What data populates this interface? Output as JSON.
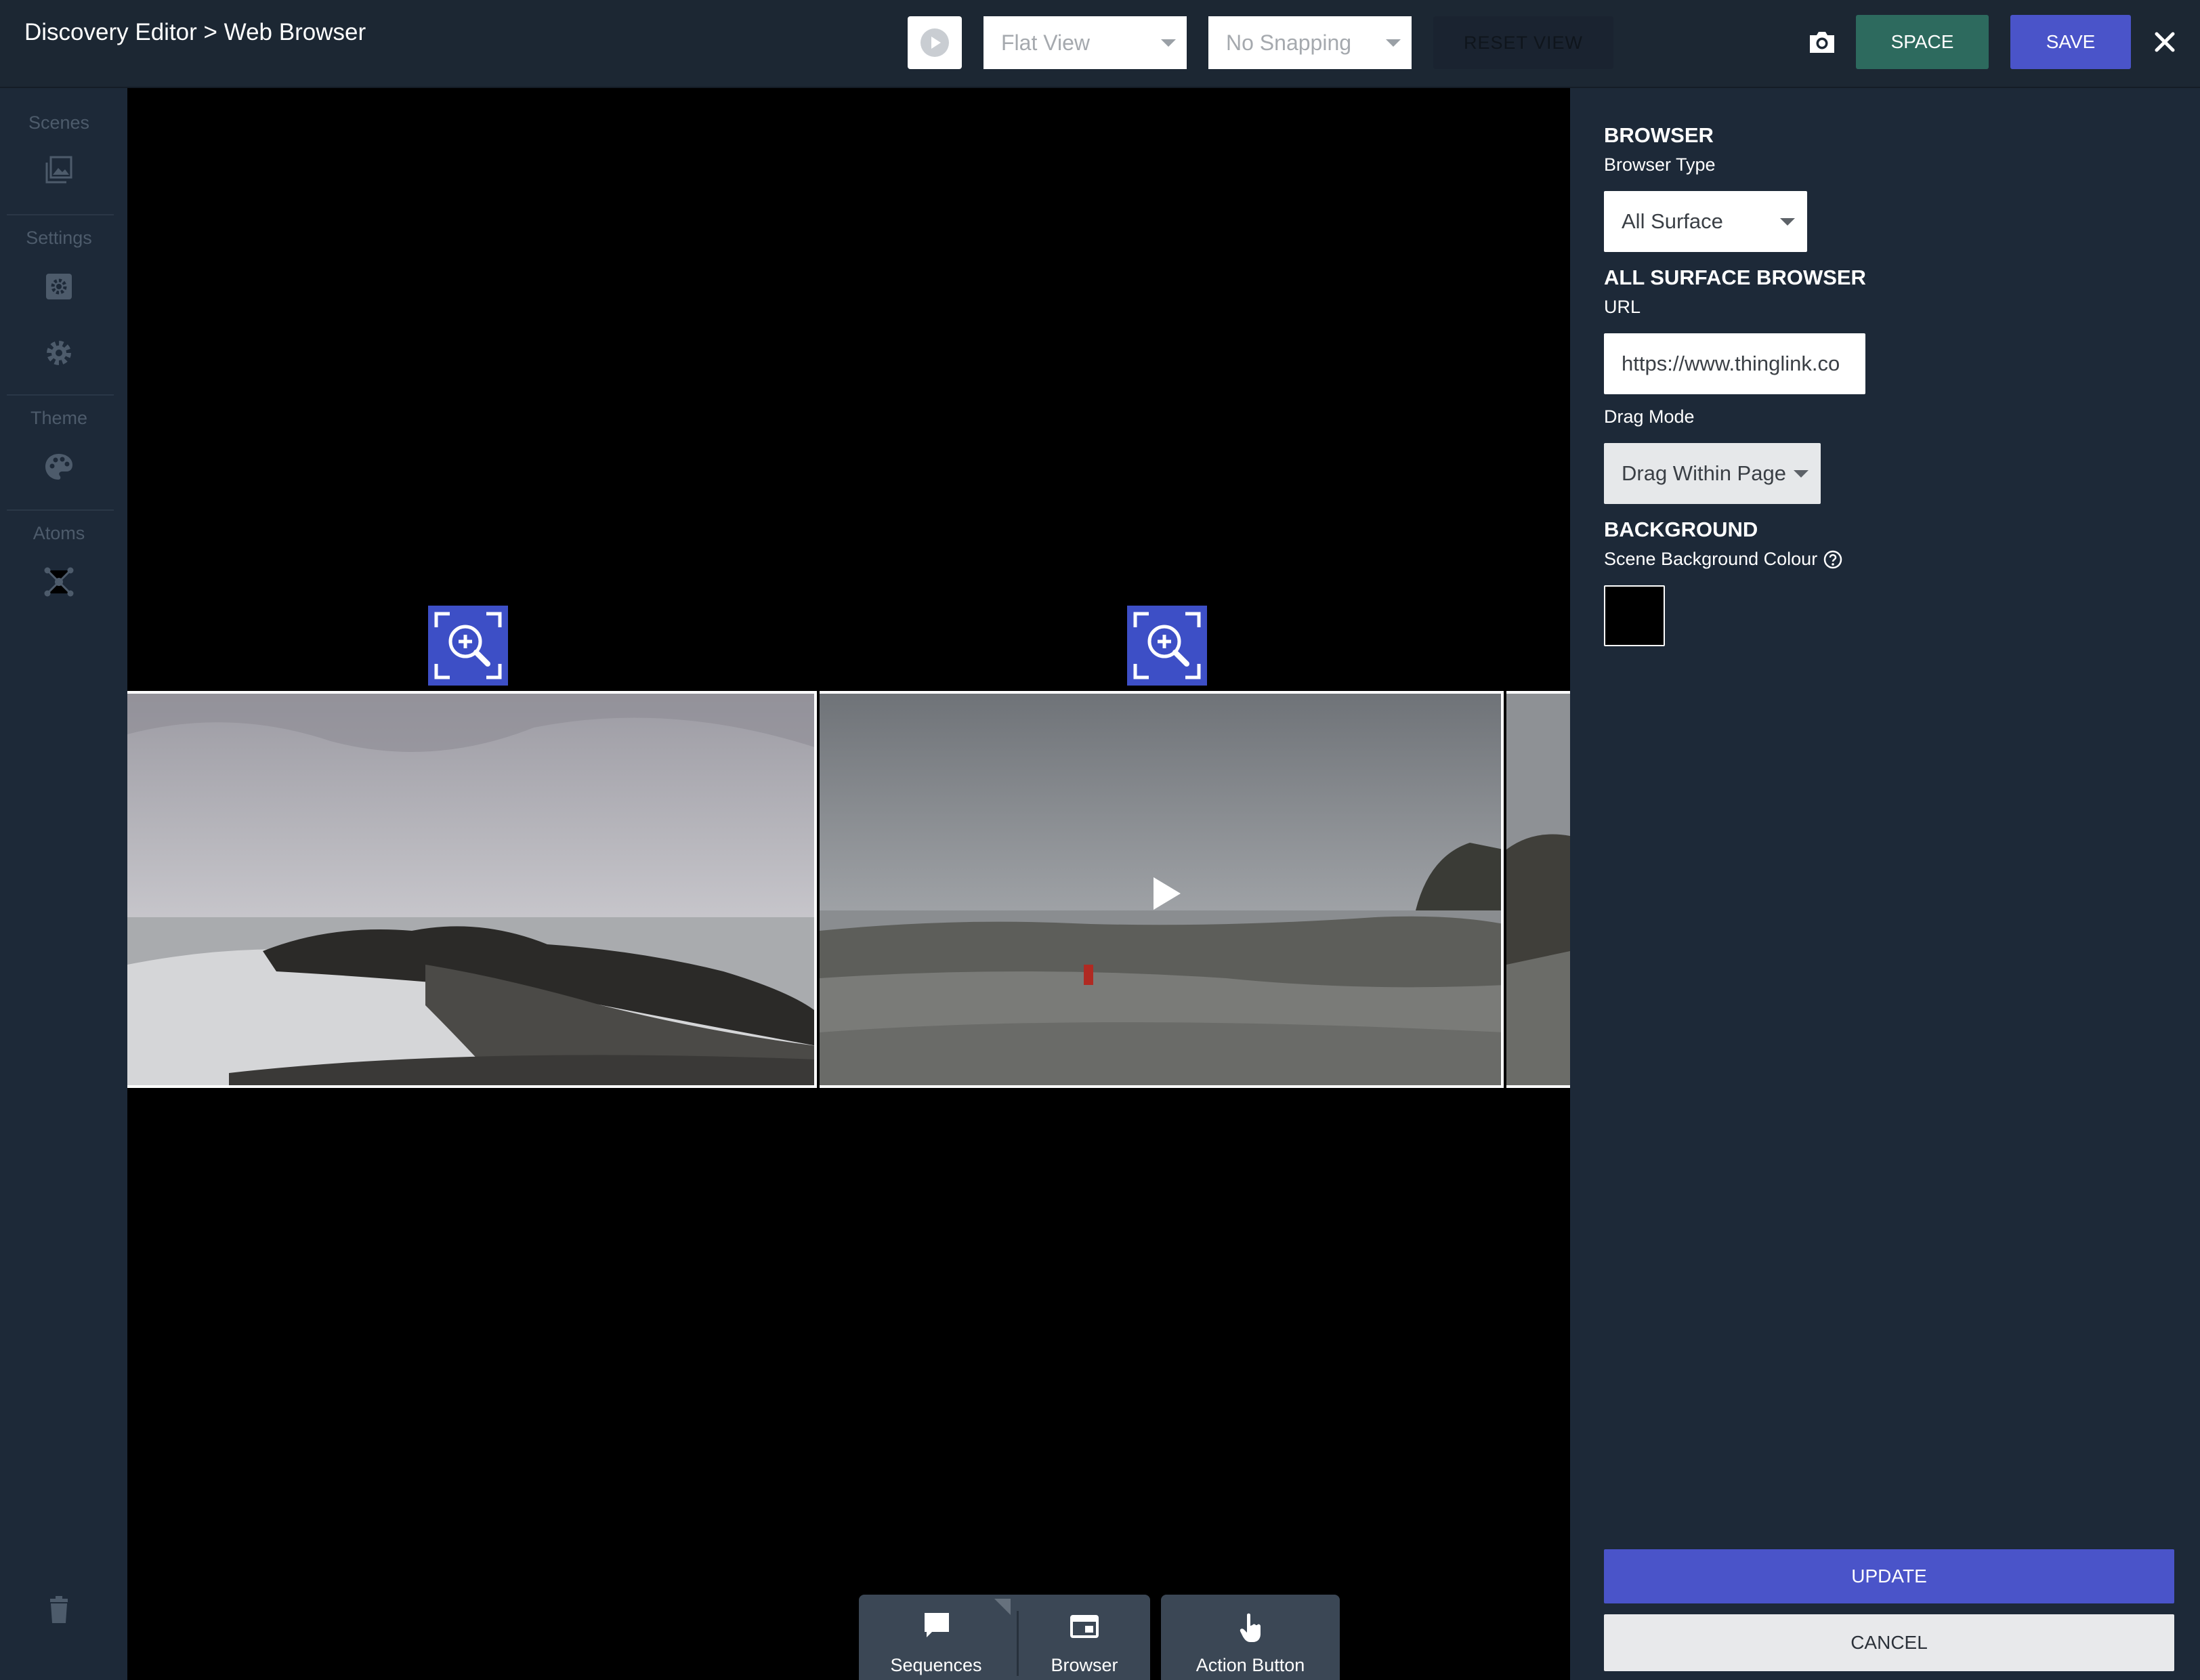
{
  "header": {
    "breadcrumb": "Discovery Editor > Web Browser",
    "view_mode": "Flat View",
    "snapping": "No Snapping",
    "reset_view": "RESET VIEW",
    "space_label": "SPACE",
    "save_label": "SAVE",
    "icons": [
      "play-icon",
      "camera-icon",
      "close-icon"
    ]
  },
  "sidebar": {
    "sections": [
      {
        "label": "Scenes",
        "icons": [
          "image-gallery-icon"
        ]
      },
      {
        "label": "Settings",
        "icons": [
          "scene-settings-icon",
          "gear-icon"
        ]
      },
      {
        "label": "Theme",
        "icons": [
          "palette-icon"
        ]
      },
      {
        "label": "Atoms",
        "icons": [
          "network-nodes-icon"
        ]
      }
    ],
    "footer_icon": "trash-icon"
  },
  "canvas": {
    "hotspot_icons": [
      "zoom-in-icon",
      "zoom-in-icon"
    ],
    "video_play_icon": "play-icon"
  },
  "bottom_tools": {
    "items": [
      {
        "label": "Sequences",
        "icon": "speech-bubble-icon"
      },
      {
        "label": "Browser",
        "icon": "browser-window-icon"
      },
      {
        "label": "Action Button",
        "icon": "pointer-hand-icon"
      }
    ]
  },
  "panel": {
    "browser_heading": "BROWSER",
    "browser_type_label": "Browser Type",
    "browser_type_value": "All Surface",
    "surface_heading": "ALL SURFACE BROWSER",
    "url_label": "URL",
    "url_value": "https://www.thinglink.co",
    "drag_mode_label": "Drag Mode",
    "drag_mode_value": "Drag Within Page",
    "background_heading": "BACKGROUND",
    "bg_colour_label": "Scene Background Colour",
    "bg_colour_value": "#000000",
    "update_label": "UPDATE",
    "cancel_label": "CANCEL"
  },
  "colors": {
    "accent": "#4a54c9",
    "space_button": "#2d6a5e",
    "background": "#1d2938"
  }
}
